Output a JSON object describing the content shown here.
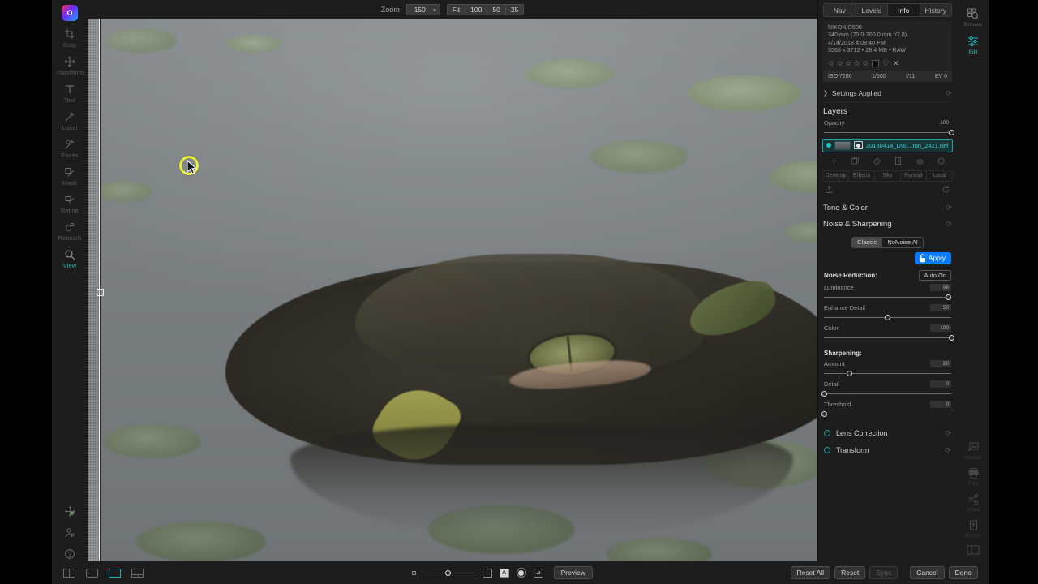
{
  "app": {
    "logo_text": "O"
  },
  "toolbar_left": {
    "items": [
      {
        "label": "Crop",
        "icon": "crop-icon"
      },
      {
        "label": "Transform",
        "icon": "transform-icon"
      },
      {
        "label": "Text",
        "icon": "text-icon"
      },
      {
        "label": "Local",
        "icon": "local-adjust-icon"
      },
      {
        "label": "Faces",
        "icon": "faces-icon"
      },
      {
        "label": "Mask",
        "icon": "mask-icon"
      },
      {
        "label": "Refine",
        "icon": "refine-icon"
      },
      {
        "label": "Retouch",
        "icon": "retouch-icon"
      },
      {
        "label": "View",
        "icon": "view-zoom-icon",
        "active": true
      }
    ],
    "bottom_icons": [
      "pan-icon",
      "person-icon",
      "help-icon"
    ]
  },
  "topbar": {
    "zoom_label": "Zoom",
    "zoom_value": "150",
    "presets": [
      "Fit",
      "100",
      "50",
      "25"
    ]
  },
  "canvas": {
    "split_compare": true,
    "brush_cursor_color": "#e8f03a"
  },
  "right_panel": {
    "tabs": [
      {
        "label": "Nav",
        "selected": false
      },
      {
        "label": "Levels",
        "selected": false
      },
      {
        "label": "Info",
        "selected": true
      },
      {
        "label": "History",
        "selected": false
      }
    ],
    "metadata": {
      "camera": "NIKON D500",
      "lens": "340 mm (70.0-200.0 mm f/2.8)",
      "datetime": "4/14/2018 4:08:40 PM",
      "dimensions": "5568 x 3712  •  28.4 MB  •  RAW",
      "rating_stars": 5,
      "exif": [
        {
          "label": "ISO 7200"
        },
        {
          "label": "1/500"
        },
        {
          "label": "f/11"
        },
        {
          "label": "EV 0"
        }
      ]
    },
    "settings_applied": {
      "label": "Settings Applied",
      "expand_icon": "chevron-right-icon"
    },
    "layers": {
      "title": "Layers",
      "opacity_label": "Opacity",
      "opacity_value": "100",
      "layer_name": "20180414_D50...ton_2421.nef",
      "action_icons": [
        "add-layer-icon",
        "copy-layer-icon",
        "paint-layer-icon",
        "delete-layer-icon",
        "stack-icon",
        "refresh-icon"
      ],
      "category_pills": [
        "Develop",
        "Effects",
        "Sky",
        "Portrait",
        "Local"
      ],
      "upload_icon": "upload-icon",
      "reset_icon": "reset-icon"
    },
    "sections": [
      {
        "label": "Tone & Color",
        "reset_icon": "reset-icon"
      },
      {
        "label": "Noise & Sharpening",
        "reset_icon": "reset-icon"
      }
    ],
    "noise_mode": {
      "options": [
        "Classic",
        "NoNoise AI"
      ],
      "selected": "Classic"
    },
    "apply_button": {
      "label": "Apply",
      "icon": "unlock-icon",
      "color": "#0a7bff"
    },
    "noise_reduction": {
      "title": "Noise Reduction:",
      "auto_label": "Auto On",
      "sliders": [
        {
          "name": "Luminance",
          "value": "98",
          "pct": 98
        },
        {
          "name": "Enhance Detail",
          "value": "50",
          "pct": 50
        },
        {
          "name": "Color",
          "value": "100",
          "pct": 100
        }
      ]
    },
    "sharpening": {
      "title": "Sharpening:",
      "sliders": [
        {
          "name": "Amount",
          "value": "20",
          "pct": 20
        },
        {
          "name": "Detail",
          "value": "0",
          "pct": 0
        },
        {
          "name": "Threshold",
          "value": "0",
          "pct": 0
        }
      ]
    },
    "tools": [
      {
        "label": "Lens Correction",
        "enabled": false
      },
      {
        "label": "Transform",
        "enabled": false
      }
    ]
  },
  "right_rail": {
    "top": [
      {
        "label": "Browse",
        "icon": "browse-icon",
        "active": false
      },
      {
        "label": "Edit",
        "icon": "edit-sliders-icon",
        "active": true
      }
    ],
    "bottom": [
      {
        "label": "Resize",
        "icon": "resize-icon"
      },
      {
        "label": "Print",
        "icon": "print-icon"
      },
      {
        "label": "Share",
        "icon": "share-icon"
      },
      {
        "label": "Export",
        "icon": "export-icon"
      }
    ],
    "panel_toggle_icon": "panel-toggle-icon"
  },
  "bottom_bar": {
    "view_icons": [
      "split-view-icon",
      "single-view-icon",
      "filmstrip-view-icon",
      "grid-view-icon"
    ],
    "selected_view_index": 2,
    "thumb_size_value": 42,
    "toggles": [
      "bounds-toggle-icon",
      "letter-toggle-icon",
      "circle-toggle-icon",
      "mask-toggle-icon"
    ],
    "preview_label": "Preview",
    "buttons": [
      {
        "label": "Reset All",
        "disabled": false
      },
      {
        "label": "Reset",
        "disabled": false
      },
      {
        "label": "Sync",
        "disabled": true
      },
      {
        "label": "Cancel",
        "disabled": false
      },
      {
        "label": "Done",
        "disabled": false
      }
    ]
  }
}
